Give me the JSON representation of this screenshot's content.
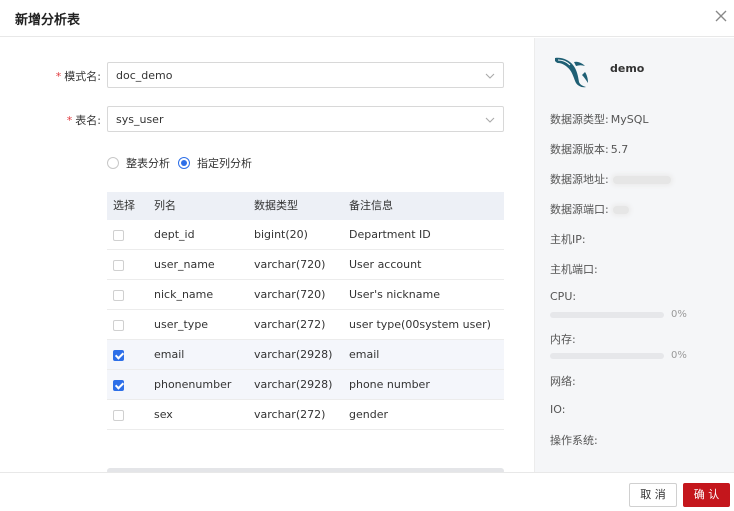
{
  "dialog": {
    "title": "新增分析表",
    "close_icon": "close-icon"
  },
  "form": {
    "schema": {
      "required_mark": "*",
      "label": "模式名:",
      "value": "doc_demo"
    },
    "table": {
      "required_mark": "*",
      "label": "表名:",
      "value": "sys_user"
    }
  },
  "analysis_mode": {
    "options": [
      {
        "label": "整表分析",
        "checked": false
      },
      {
        "label": "指定列分析",
        "checked": true
      }
    ]
  },
  "columns_table": {
    "headers": [
      "选择",
      "列名",
      "数据类型",
      "备注信息"
    ],
    "rows": [
      {
        "checked": false,
        "name": "dept_id",
        "type": "bigint(20)",
        "comment": "Department ID"
      },
      {
        "checked": false,
        "name": "user_name",
        "type": "varchar(720)",
        "comment": "User account"
      },
      {
        "checked": false,
        "name": "nick_name",
        "type": "varchar(720)",
        "comment": "User's nickname"
      },
      {
        "checked": false,
        "name": "user_type",
        "type": "varchar(272)",
        "comment": "user type(00system user)"
      },
      {
        "checked": true,
        "name": "email",
        "type": "varchar(2928)",
        "comment": "email"
      },
      {
        "checked": true,
        "name": "phonenumber",
        "type": "varchar(2928)",
        "comment": "phone number"
      },
      {
        "checked": false,
        "name": "sex",
        "type": "varchar(272)",
        "comment": "gender"
      }
    ]
  },
  "datasource": {
    "logo_icon": "mysql-dolphin-icon",
    "name": "demo",
    "type_label": "数据源类型:",
    "type_value": "MySQL",
    "version_label": "数据源版本:",
    "version_value": "5.7",
    "address_label": "数据源地址:",
    "port_label": "数据源端口:",
    "host_ip_label": "主机IP:",
    "host_port_label": "主机端口:",
    "cpu_label": "CPU:",
    "cpu_percent": "0%",
    "cpu_usage": 0,
    "memory_label": "内存:",
    "memory_percent": "0%",
    "memory_usage": 0,
    "network_label": "网络:",
    "io_label": "IO:",
    "os_label": "操作系统:"
  },
  "footer": {
    "cancel_label": "取 消",
    "ok_label": "确 认"
  },
  "colors": {
    "accent_blue": "#2d6fe8",
    "confirm_red": "#c4161c",
    "required_red": "#e0393e",
    "logo_teal": "#1f5f74"
  }
}
